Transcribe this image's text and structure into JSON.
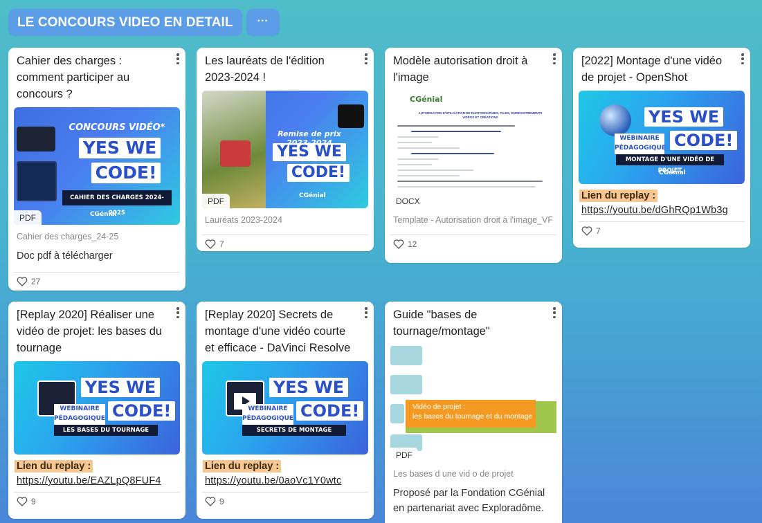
{
  "section": {
    "title": "LE CONCOURS VIDEO EN DETAIL",
    "more_label": "···"
  },
  "cards": [
    {
      "title": "Cahier des charges : comment participer au concours ?",
      "badge": "PDF",
      "thumb_text": {
        "top": "CONCOURS VIDÉO*",
        "line1": "YES WE",
        "line2": "CODE!",
        "bar": "CAHIER DES CHARGES 2024-2025",
        "brand": "CGénial"
      },
      "filename": "Cahier des charges_24-25",
      "description": "Doc pdf à télécharger",
      "likes": "27"
    },
    {
      "title": "Les lauréats de l'édition 2023-2024 !",
      "badge": "PDF",
      "thumb_text": {
        "top": "Remise de prix 2023-2024",
        "line1": "YES WE",
        "line2": "CODE!",
        "brand": "CGénial"
      },
      "filename": "Lauréats 2023-2024",
      "likes": "7"
    },
    {
      "title": "Modèle autorisation droit à l'image",
      "badge": "DOCX",
      "thumb_text": {
        "brand": "CGénial",
        "heading": "AUTORISATION D'UTILISATION DE PHOTOGRAPHIES, FILMS, ENREGISTREMENTS VIDÉOS ET CRÉATIONS"
      },
      "filename": "Template - Autorisation droit à l'image_VF",
      "likes": "12"
    },
    {
      "title": "[2022] Montage d'une vidéo de projet - OpenShot",
      "thumb_text": {
        "line1": "YES WE",
        "line2": "CODE!",
        "tag": "WEBINAIRE PÉDAGOGIQUE",
        "bar": "MONTAGE D'UNE VIDÉO DE PROJET",
        "brand": "CGénial"
      },
      "replay_label": "Lien du replay :",
      "replay_url": "https://youtu.be/dGhRQp1Wb3g",
      "likes": "7"
    },
    {
      "title": "[Replay 2020] Réaliser une vidéo de projet: les bases du tournage",
      "thumb_text": {
        "line1": "YES WE",
        "line2": "CODE!",
        "tag": "WEBINAIRE PÉDAGOGIQUE",
        "bar": "LES BASES DU TOURNAGE"
      },
      "replay_label": "Lien du replay :",
      "replay_url": "https://youtu.be/EAZLpQ8FUF4",
      "likes": "9"
    },
    {
      "title": "[Replay  2020] Secrets de montage d'une vidéo courte et efficace - DaVinci Resolve",
      "thumb_text": {
        "line1": "YES WE",
        "line2": "CODE!",
        "tag": "WEBINAIRE PÉDAGOGIQUE",
        "bar": "SECRETS DE MONTAGE"
      },
      "replay_label": "Lien du replay :",
      "replay_url": "https://youtu.be/0aoVc1Y0wtc",
      "likes": "9"
    },
    {
      "title": "Guide \"bases de tournage/montage\"",
      "badge": "PDF",
      "thumb_text": {
        "line1": "Vidéo de projet :",
        "line2": "les bases du tournage et du montage"
      },
      "filename": "Les bases d une vid o de projet",
      "description": "Proposé par la Fondation CGénial en partenariat avec Exploradôme."
    }
  ],
  "colors": {
    "accent": "#5b9de6",
    "replay_highlight": "#f8c690",
    "bg_top": "#4fbcc9",
    "bg_bottom": "#4a86d8"
  }
}
